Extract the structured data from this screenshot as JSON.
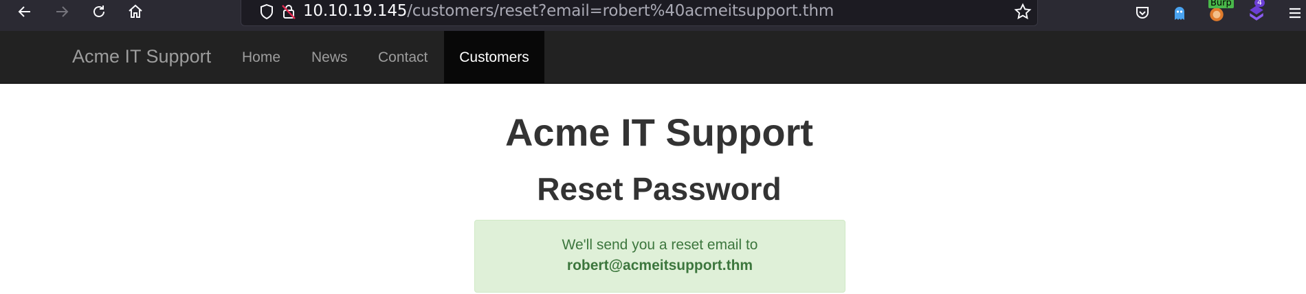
{
  "browser": {
    "url_host": "10.10.19.145",
    "url_path": "/customers/reset?email=robert%40acmeitsupport.thm",
    "extensions": {
      "burp_label": "Burp",
      "badge_count": "4"
    },
    "icons": [
      "back-arrow-icon",
      "forward-arrow-icon",
      "reload-icon",
      "home-icon",
      "shield-icon",
      "insecure-lock-icon",
      "star-icon",
      "pocket-icon",
      "ghost-icon",
      "burp-icon",
      "extension-icon",
      "menu-icon"
    ]
  },
  "navbar": {
    "brand": "Acme IT Support",
    "links": [
      {
        "label": "Home"
      },
      {
        "label": "News"
      },
      {
        "label": "Contact"
      },
      {
        "label": "Customers",
        "active": true
      }
    ]
  },
  "main": {
    "title": "Acme IT Support",
    "subtitle": "Reset Password",
    "alert": {
      "message": "We'll send you a reset email to",
      "email": "robert@acmeitsupport.thm"
    }
  },
  "colors": {
    "navbar_bg": "#222222",
    "active_tab_bg": "#080808",
    "alert_bg": "#dff0d8",
    "alert_text": "#3c763d"
  }
}
